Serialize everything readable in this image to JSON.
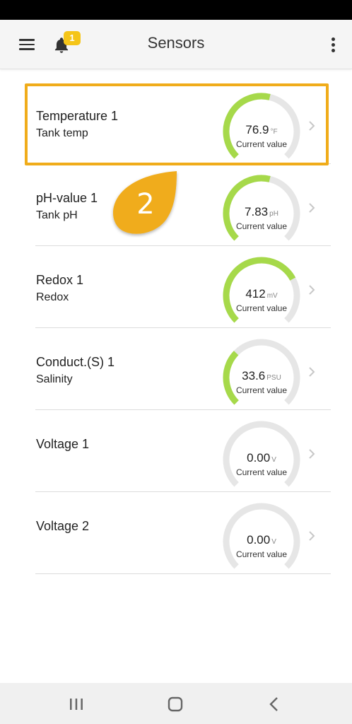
{
  "header": {
    "title": "Sensors",
    "notification_count": "1"
  },
  "sensors": [
    {
      "name": "Temperature 1",
      "subtitle": "Tank temp",
      "value": "76.9",
      "unit": "°F",
      "caption": "Current value",
      "fill": 0.55
    },
    {
      "name": "pH-value 1",
      "subtitle": "Tank pH",
      "value": "7.83",
      "unit": "pH",
      "caption": "Current value",
      "fill": 0.55
    },
    {
      "name": "Redox 1",
      "subtitle": "Redox",
      "value": "412",
      "unit": "mV",
      "caption": "Current value",
      "fill": 0.73
    },
    {
      "name": "Conduct.(S) 1",
      "subtitle": "Salinity",
      "value": "33.6",
      "unit": "PSU",
      "caption": "Current value",
      "fill": 0.33
    },
    {
      "name": "Voltage 1",
      "subtitle": "",
      "value": "0.00",
      "unit": "V",
      "caption": "Current value",
      "fill": 0
    },
    {
      "name": "Voltage 2",
      "subtitle": "",
      "value": "0.00",
      "unit": "V",
      "caption": "Current value",
      "fill": 0
    }
  ],
  "annotation": {
    "step": "2"
  },
  "colors": {
    "gauge_fill": "#a6d94a",
    "gauge_track": "#e6e6e6",
    "highlight": "#f0ac1a",
    "badge": "#f5c518"
  },
  "icons": {
    "menu": "hamburger-menu-icon",
    "notifications": "bell-icon",
    "more": "more-vertical-icon",
    "row_action": "chevron-right-icon",
    "nav_recents": "recents-icon",
    "nav_home": "home-icon",
    "nav_back": "back-icon"
  }
}
